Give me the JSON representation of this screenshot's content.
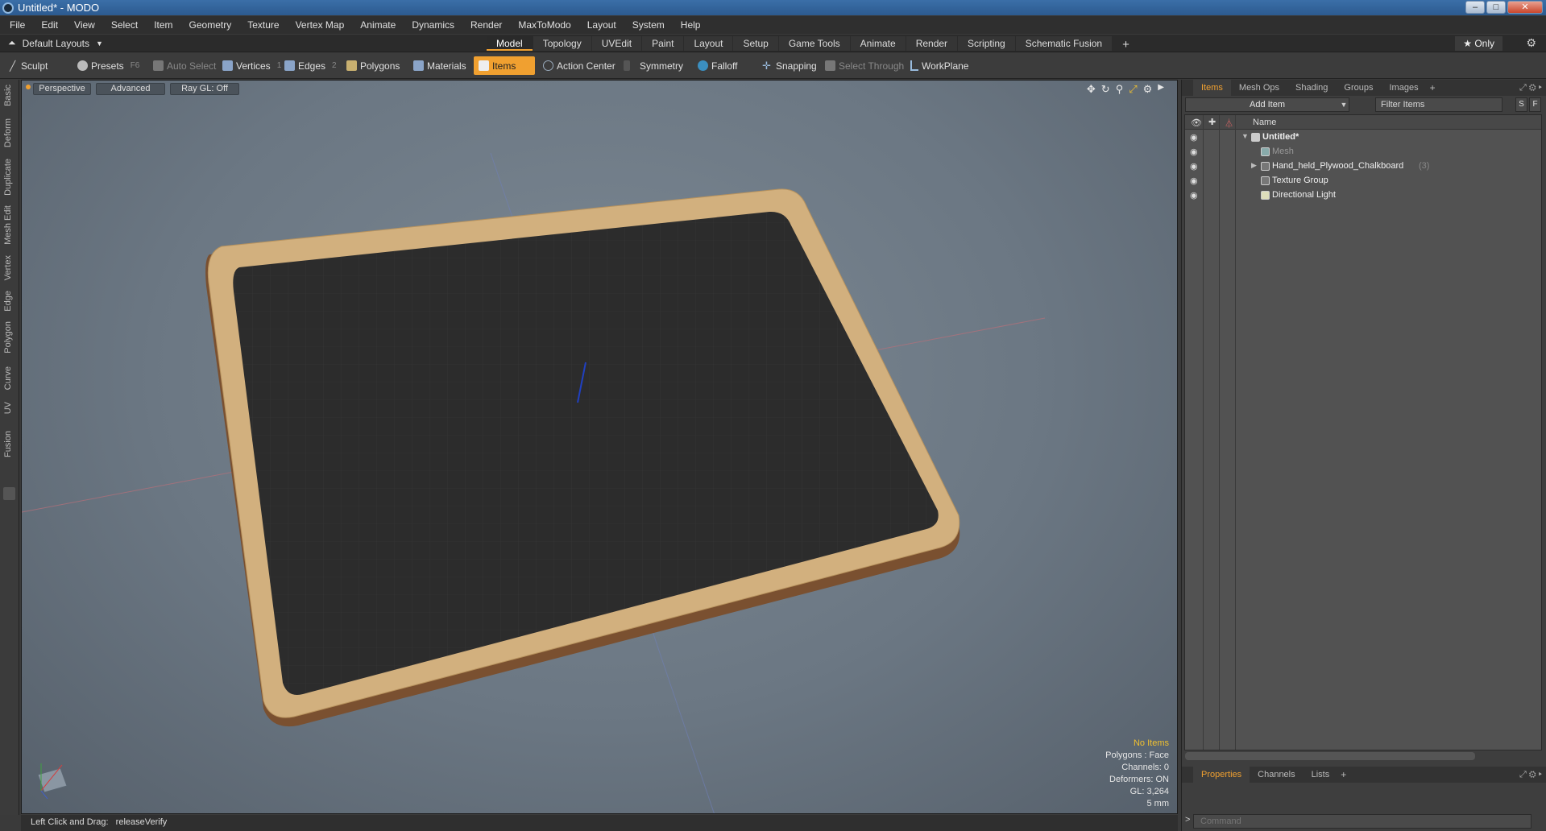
{
  "window": {
    "title": "Untitled* - MODO",
    "min": "–",
    "max": "□",
    "close": "✕"
  },
  "menu": [
    "File",
    "Edit",
    "View",
    "Select",
    "Item",
    "Geometry",
    "Texture",
    "Vertex Map",
    "Animate",
    "Dynamics",
    "Render",
    "MaxToModo",
    "Layout",
    "System",
    "Help"
  ],
  "layouts": {
    "current": "Default Layouts",
    "tabs": [
      "Model",
      "Topology",
      "UVEdit",
      "Paint",
      "Layout",
      "Setup",
      "Game Tools",
      "Animate",
      "Render",
      "Scripting",
      "Schematic Fusion"
    ],
    "active": "Model",
    "add": "+",
    "only": "★ Only"
  },
  "toolbar": {
    "sculpt": "Sculpt",
    "presets": "Presets",
    "presets_key": "F6",
    "auto_select": "Auto Select",
    "vertices": "Vertices",
    "vertices_key": "1",
    "edges": "Edges",
    "edges_key": "2",
    "polygons": "Polygons",
    "materials": "Materials",
    "items": "Items",
    "action_center": "Action Center",
    "symmetry": "Symmetry",
    "falloff": "Falloff",
    "snapping": "Snapping",
    "select_through": "Select Through",
    "workplane": "WorkPlane"
  },
  "left_tabs": [
    "Basic",
    "Deform",
    "Duplicate",
    "Mesh Edit",
    "Vertex",
    "Edge",
    "Polygon",
    "Curve",
    "UV",
    "Fusion"
  ],
  "viewport": {
    "view": "Perspective",
    "shading": "Advanced",
    "raygl": "Ray GL: Off",
    "info": {
      "items": "No Items",
      "polygons": "Polygons : Face",
      "channels": "Channels: 0",
      "deformers": "Deformers: ON",
      "gl": "GL: 3,264",
      "grid": "5 mm"
    }
  },
  "status": {
    "hint": "Left Click and Drag:",
    "action": "releaseVerify"
  },
  "items_panel": {
    "tabs": [
      "Items",
      "Mesh Ops",
      "Shading",
      "Groups",
      "Images"
    ],
    "active": "Items",
    "add_item": "Add Item",
    "filter": "Filter Items",
    "s_btn": "S",
    "f_btn": "F",
    "name_col": "Name",
    "rows": [
      {
        "label": "Untitled*"
      },
      {
        "label": "Mesh"
      },
      {
        "label": "Hand_held_Plywood_Chalkboard",
        "count": "(3)"
      },
      {
        "label": "Texture Group"
      },
      {
        "label": "Directional Light"
      }
    ]
  },
  "props_panel": {
    "tabs": [
      "Properties",
      "Channels",
      "Lists"
    ],
    "active": "Properties",
    "command_placeholder": "Command",
    "prompt": ">"
  },
  "colors": {
    "accent": "#f0a030",
    "chalkboard": "#2c2c2c",
    "frame": "#d2b07e"
  }
}
